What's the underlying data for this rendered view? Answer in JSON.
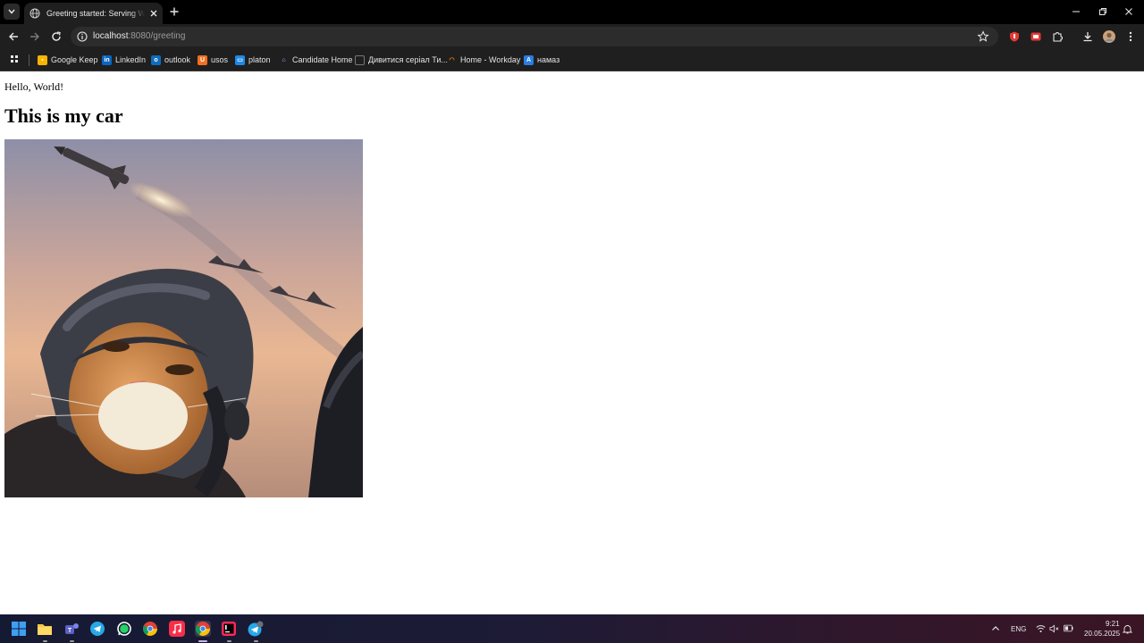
{
  "browser": {
    "tab": {
      "title": "Greeting started: Serving Web Content"
    },
    "url": {
      "host": "localhost",
      "path": ":8080/greeting"
    },
    "bookmarks": [
      {
        "label": "Google Keep",
        "icon": "google-keep-icon",
        "color": "#f6b400"
      },
      {
        "label": "LinkedIn",
        "icon": "linkedin-icon",
        "color": "#0a66c2"
      },
      {
        "label": "outlook",
        "icon": "outlook-icon",
        "color": "#0f6cbd"
      },
      {
        "label": "usos",
        "icon": "usos-icon",
        "color": "#f37021"
      },
      {
        "label": "platon",
        "icon": "platon-icon",
        "color": "#1e88e5"
      },
      {
        "label": "Candidate Home",
        "icon": "candidate-home-icon",
        "color": "#3b82f6"
      },
      {
        "label": "Дивитися серіал Ти...",
        "icon": "film-icon",
        "color": "#555555"
      },
      {
        "label": "Home - Workday",
        "icon": "workday-icon",
        "color": "#f38b00"
      },
      {
        "label": "намаз",
        "icon": "namaz-icon",
        "color": "#2a7de1"
      }
    ]
  },
  "page": {
    "greeting": "Hello, World!",
    "heading": "This is my car"
  },
  "taskbar": {
    "apps": [
      {
        "icon": "windows-start-icon"
      },
      {
        "icon": "file-explorer-icon"
      },
      {
        "icon": "teams-icon"
      },
      {
        "icon": "telegram-icon"
      },
      {
        "icon": "whatsapp-icon"
      },
      {
        "icon": "chrome-icon"
      },
      {
        "icon": "apple-music-icon"
      },
      {
        "icon": "chrome-active-icon"
      },
      {
        "icon": "intellij-icon"
      },
      {
        "icon": "telegram-badge-icon"
      }
    ],
    "tray": {
      "language": "ENG",
      "time": "9:21",
      "date": "20.05.2025"
    }
  },
  "colors": {
    "tab_strip": "#000000",
    "toolbar": "#1f1f1f",
    "omnibox": "#2c2c2c",
    "page_bg": "#ffffff"
  }
}
